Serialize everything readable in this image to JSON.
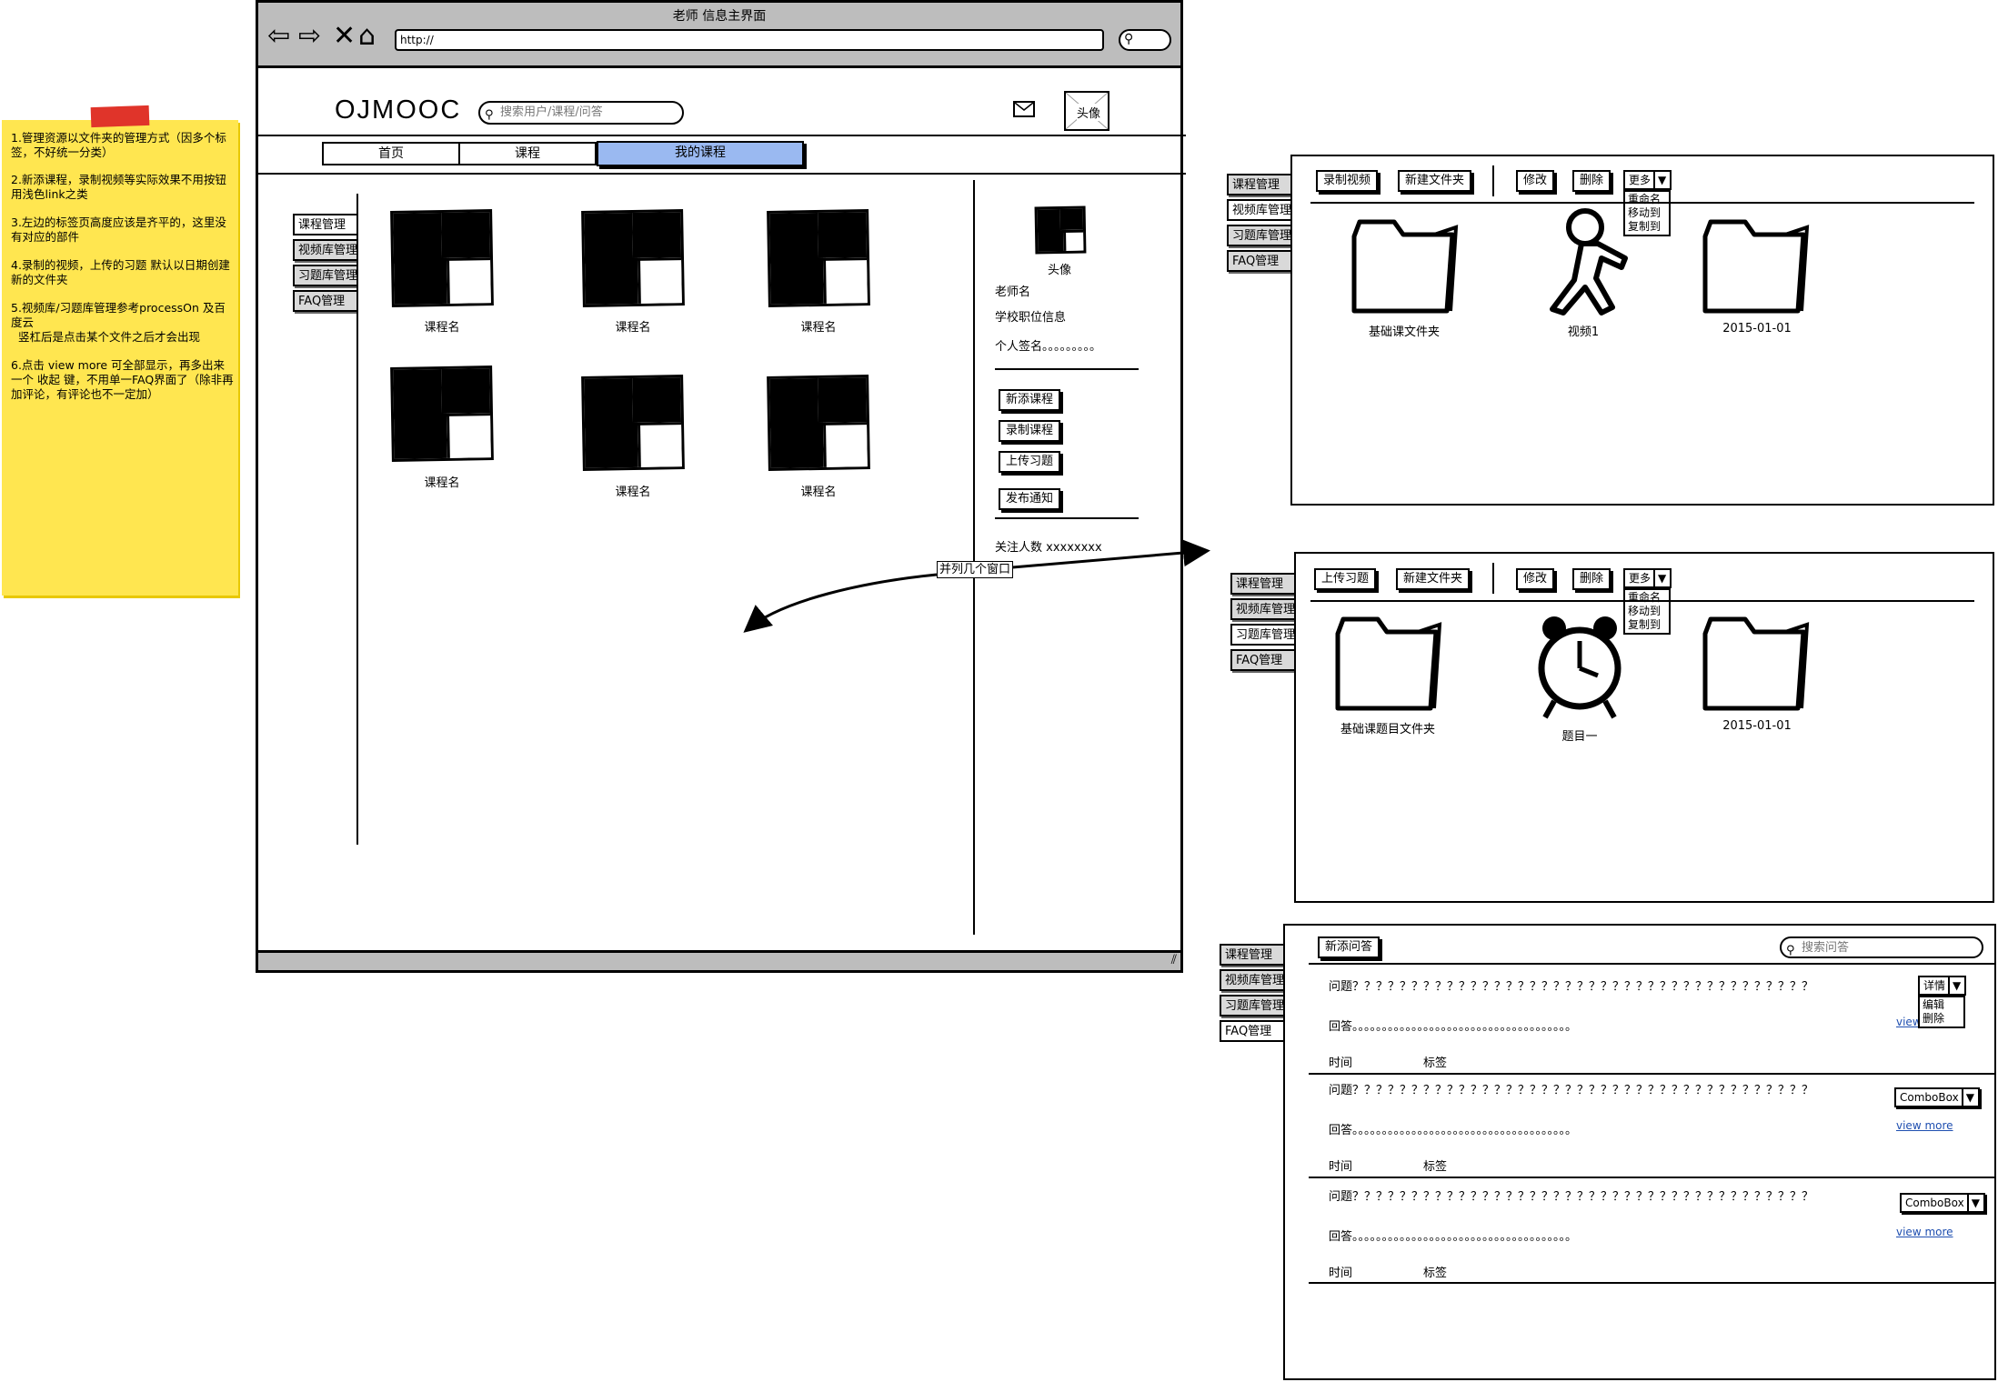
{
  "sticky_note": {
    "lines": [
      "1.管理资源以文件夹的管理方式（因多个标签，不好统一分类）",
      "2.新添课程，录制视频等实际效果不用按钮 用浅色link之类",
      "3.左边的标签页高度应该是齐平的，这里没有对应的部件",
      "4.录制的视频，上传的习题 默认以日期创建新的文件夹",
      "5.视频库/习题库管理参考processOn 及百度云\n  竖杠后是点击某个文件之后才会出现",
      "6.点击 view more 可全部显示，再多出来一个 收起 键，不用单一FAQ界面了（除非再加评论，有评论也不一定加）"
    ]
  },
  "browser": {
    "title": "老师 信息主界面",
    "url": "http://",
    "icons": [
      "back-arrow-icon",
      "forward-arrow-icon",
      "stop-icon",
      "home-icon"
    ]
  },
  "site": {
    "logo": "OJMOOC",
    "search_placeholder": "搜索用户/课程/问答",
    "avatar_label": "头像",
    "nav_tabs": [
      "首页",
      "课程",
      "我的课程"
    ],
    "active_tab": "我的课程"
  },
  "side_tabs": [
    "课程管理",
    "视频库管理",
    "习题库管理",
    "FAQ管理"
  ],
  "courses": [
    "课程名",
    "课程名",
    "课程名",
    "课程名",
    "课程名",
    "课程名"
  ],
  "profile": {
    "avatar_label": "头像",
    "teacher_name": "老师名",
    "school_info": "学校职位信息",
    "signature": "个人签名。。。。。。。。。",
    "actions": [
      "新添课程",
      "录制课程",
      "上传习题",
      "发布通知"
    ],
    "followers": "关注人数  xxxxxxxx"
  },
  "annotation": {
    "arrow_label": "并列几个窗口"
  },
  "video_panel": {
    "toolbar": [
      "录制视频",
      "新建文件夹",
      "修改",
      "删除"
    ],
    "more": "更多",
    "menu": [
      "重命名",
      "移动到",
      "复制到"
    ],
    "items": [
      "基础课文件夹",
      "视频1",
      "2015-01-01"
    ]
  },
  "exercise_panel": {
    "toolbar": [
      "上传习题",
      "新建文件夹",
      "修改",
      "删除"
    ],
    "more": "更多",
    "menu": [
      "重命名",
      "移动到",
      "复制到"
    ],
    "items": [
      "基础课题目文件夹",
      "题目一",
      "2015-01-01"
    ]
  },
  "faq_panel": {
    "add_button": "新添问答",
    "search_placeholder": "搜索问答",
    "entries": [
      {
        "question": "问题？？？？？？？？？？？？？？？？？？？？？？？？？？？？？？？？？？？？？？？",
        "answer": "回答。。。。。。。。。。。。。。。。。。。。。。。。。。。。。。。。。。。。。",
        "time": "时间",
        "tag": "标签",
        "combo": "详情",
        "more": "view more"
      },
      {
        "question": "问题？？？？？？？？？？？？？？？？？？？？？？？？？？？？？？？？？？？？？？？",
        "answer": "回答。。。。。。。。。。。。。。。。。。。。。。。。。。。。。。。。。。。。。",
        "time": "时间",
        "tag": "标签",
        "combo": "ComboBox",
        "more": "view more"
      },
      {
        "question": "问题？？？？？？？？？？？？？？？？？？？？？？？？？？？？？？？？？？？？？？？",
        "answer": "回答。。。。。。。。。。。。。。。。。。。。。。。。。。。。。。。。。。。。。",
        "time": "时间",
        "tag": "标签",
        "combo": "ComboBox",
        "more": "view more"
      }
    ],
    "detail_menu": [
      "编辑",
      "删除"
    ]
  },
  "colors": {
    "sticky": "#ffe650",
    "tape": "#e0342a",
    "active_tab": "#9ab9f1",
    "chrome": "#bdbdbd",
    "link": "#1f4fb0"
  }
}
